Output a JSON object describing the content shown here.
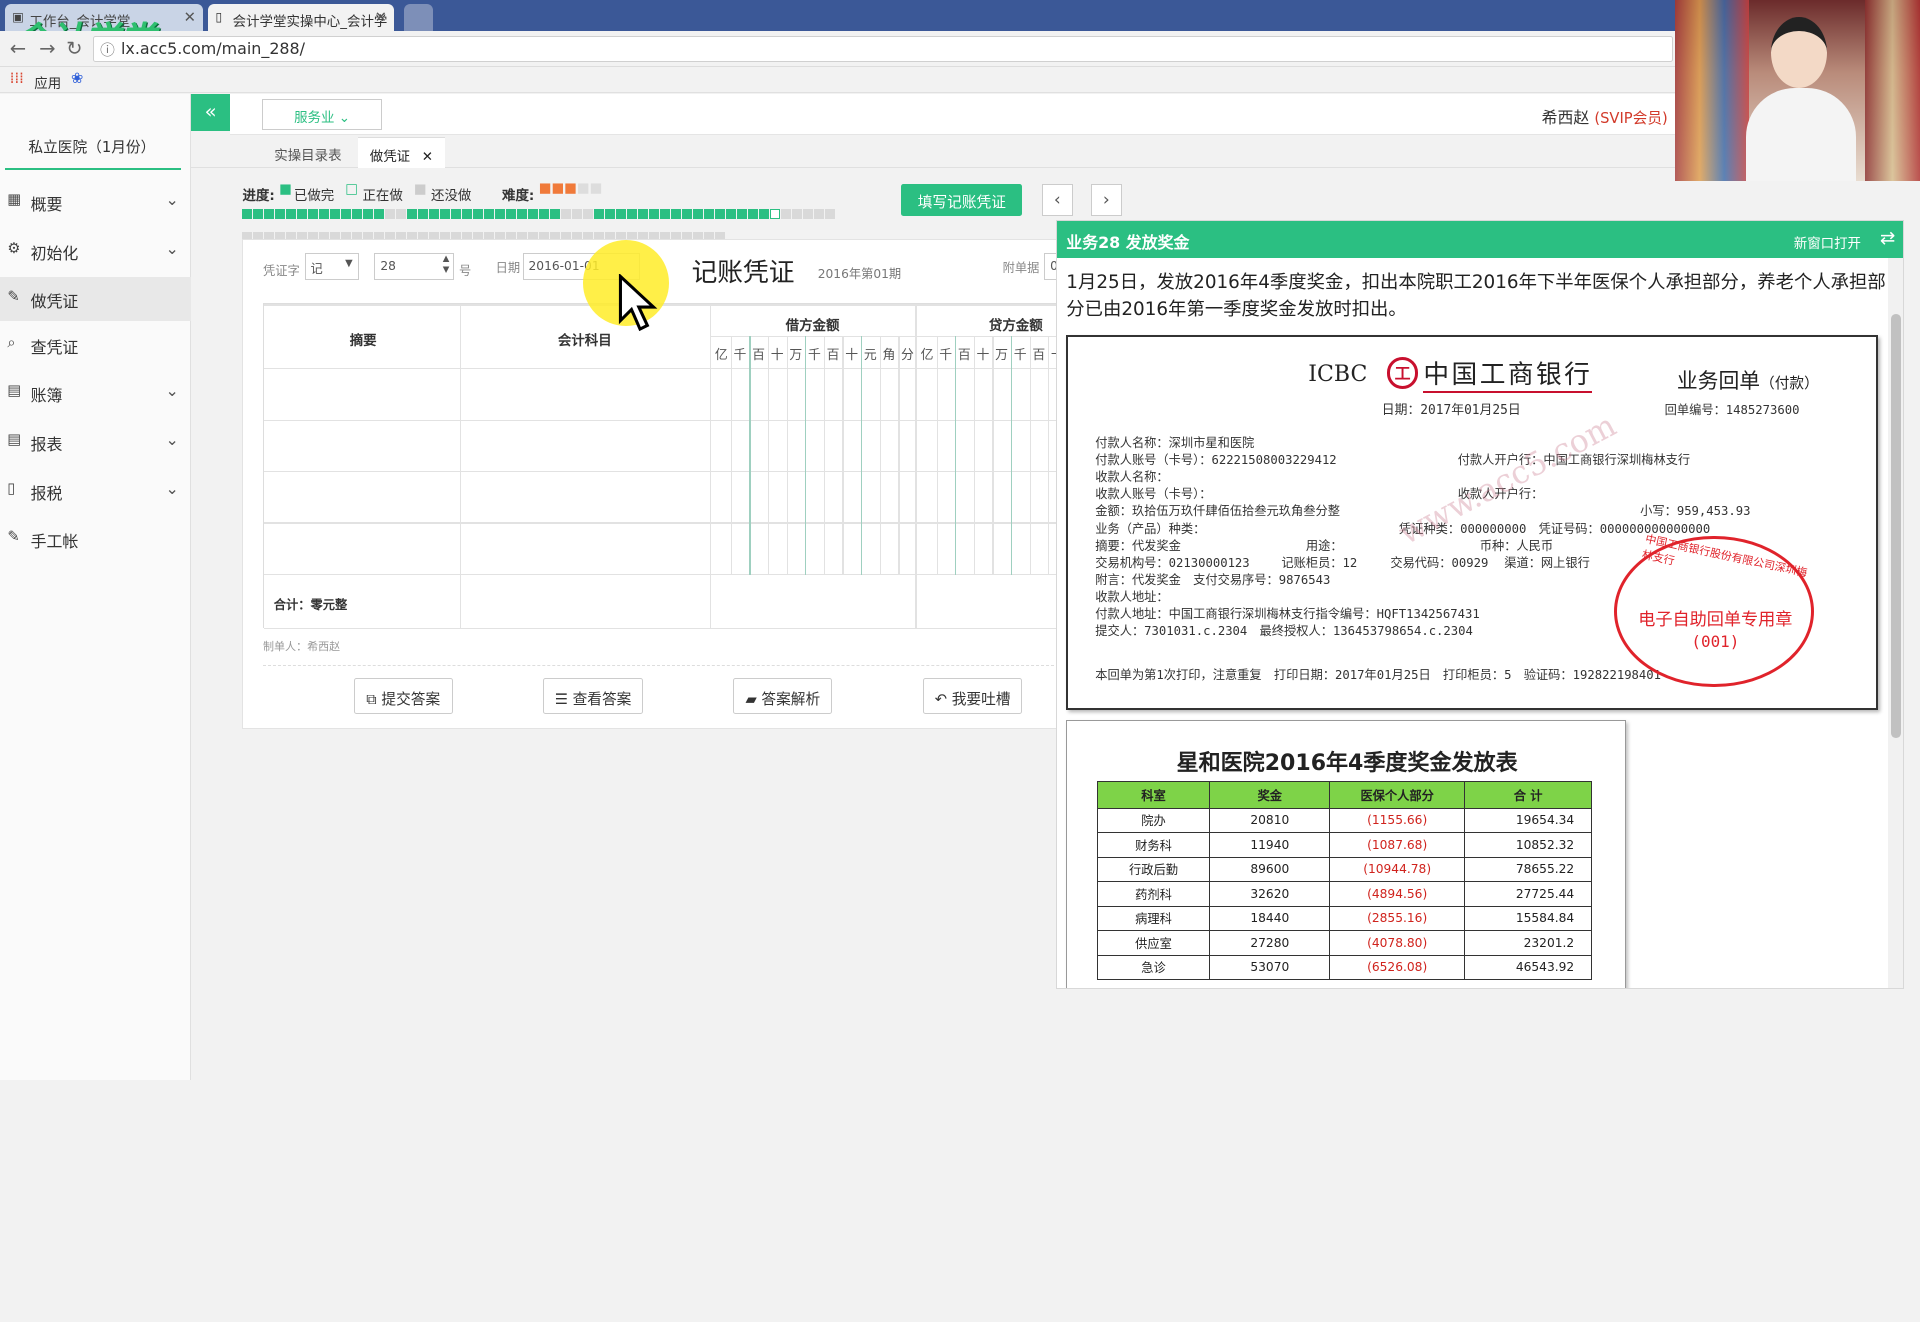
{
  "browser": {
    "tab1_title": "工作台_会计学堂",
    "tab2_title": "会计学堂实操中心_会计学",
    "url": "lx.acc5.com/main_288/",
    "bookmark_apps": "应用",
    "logo": "会计学堂"
  },
  "sidebar": {
    "company": "私立医院（1月份）",
    "items": [
      {
        "label": "概要",
        "icon": "grid-icon"
      },
      {
        "label": "初始化",
        "icon": "gear-icon"
      },
      {
        "label": "做凭证",
        "icon": "pen-icon"
      },
      {
        "label": "查凭证",
        "icon": "search-icon"
      },
      {
        "label": "账簿",
        "icon": "book-icon"
      },
      {
        "label": "报表",
        "icon": "report-icon"
      },
      {
        "label": "报税",
        "icon": "file-icon"
      },
      {
        "label": "手工帐",
        "icon": "pen-icon"
      }
    ]
  },
  "header": {
    "service": "服务业",
    "user_name": "希西赵",
    "user_level": "(SVIP会员)"
  },
  "tabs": [
    {
      "label": "实操目录表"
    },
    {
      "label": "做凭证"
    }
  ],
  "progress": {
    "label": "进度:",
    "done_label": "已做完",
    "doing_label": "正在做",
    "todo_label": "还没做",
    "difficulty_label": "难度:",
    "fill_button": "填写记账凭证"
  },
  "voucher": {
    "word_label": "凭证字",
    "word_value": "记",
    "number_value": "28",
    "number_suffix": "号",
    "date_label": "日期",
    "date_value": "2016-01-01",
    "title": "记账凭证",
    "period": "2016年第01期",
    "attach_label": "附单据",
    "attach_value": "0",
    "col_summary": "摘要",
    "col_account": "会计科目",
    "col_debit": "借方金额",
    "col_credit": "贷方金额",
    "units": [
      "亿",
      "千",
      "百",
      "十",
      "万",
      "千",
      "百",
      "十",
      "元",
      "角",
      "分"
    ],
    "total": "合计：零元整",
    "maker": "制单人：希西赵",
    "buttons": {
      "submit": "提交答案",
      "view": "查看答案",
      "analysis": "答案解析",
      "complain": "我要吐槽"
    }
  },
  "business": {
    "title": "业务28 发放奖金",
    "open_new": "新窗口打开",
    "description": "1月25日，发放2016年4季度奖金，扣出本院职工2016年下半年医保个人承担部分，养老个人承担部分已由2016年第一季度奖金发放时扣出。"
  },
  "receipt": {
    "icbc": "ICBC",
    "bank_name": "中国工商银行",
    "doc_type": "业务回单",
    "doc_type_sub": "（付款）",
    "date": "日期：2017年01月25日",
    "receipt_no": "回单编号：1485273600",
    "lines": [
      "付款人名称：深圳市星和医院",
      "付款人账号（卡号）：62221508003229412",
      "收款人名称：",
      "收款人账号（卡号）：",
      "金额：玖拾伍万玖仟肆佰伍拾叁元玖角叁分整",
      "业务（产品）种类：",
      "摘要：代发奖金",
      "交易机构号：02130000123",
      "附言：代发奖金　支付交易序号：9876543",
      "收款人地址：",
      "付款人地址：中国工商银行深圳梅林支行指令编号：HQFT1342567431",
      "提交人：7301031.c.2304　最终授权人：136453798654.c.2304"
    ],
    "payer_bank": "付款人开户行：中国工商银行深圳梅林支行",
    "payee_bank": "收款人开户行：",
    "small_amount": "小写：959,453.93",
    "voucher_type": "凭证种类：000000000　凭证号码：000000000000000",
    "purpose": "用途：",
    "currency": "币种：人民币",
    "teller": "记账柜员：12",
    "trade_code": "交易代码：00929",
    "channel": "渠道：网上银行",
    "footer": "本回单为第1次打印，注意重复　打印日期：2017年01月25日　打印柜员：5　验证码：192822198401",
    "watermark": "www.acc5.com",
    "seal_text": "中国工商银行股份有限公司深圳梅林支行",
    "seal_middle": "电子自助回单专用章",
    "seal_number": "(001)"
  },
  "bonus_table": {
    "title": "星和医院2016年4季度奖金发放表",
    "headers": [
      "科室",
      "奖金",
      "医保个人部分",
      "合  计"
    ],
    "rows": [
      [
        "院办",
        "20810",
        "(1155.66)",
        "19654.34"
      ],
      [
        "财务科",
        "11940",
        "(1087.68)",
        "10852.32"
      ],
      [
        "行政后勤",
        "89600",
        "(10944.78)",
        "78655.22"
      ],
      [
        "药剂科",
        "32620",
        "(4894.56)",
        "27725.44"
      ],
      [
        "病理科",
        "18440",
        "(2855.16)",
        "15584.84"
      ],
      [
        "供应室",
        "27280",
        "(4078.80)",
        "23201.2"
      ],
      [
        "急诊",
        "53070",
        "(6526.08)",
        "46543.92"
      ]
    ]
  }
}
